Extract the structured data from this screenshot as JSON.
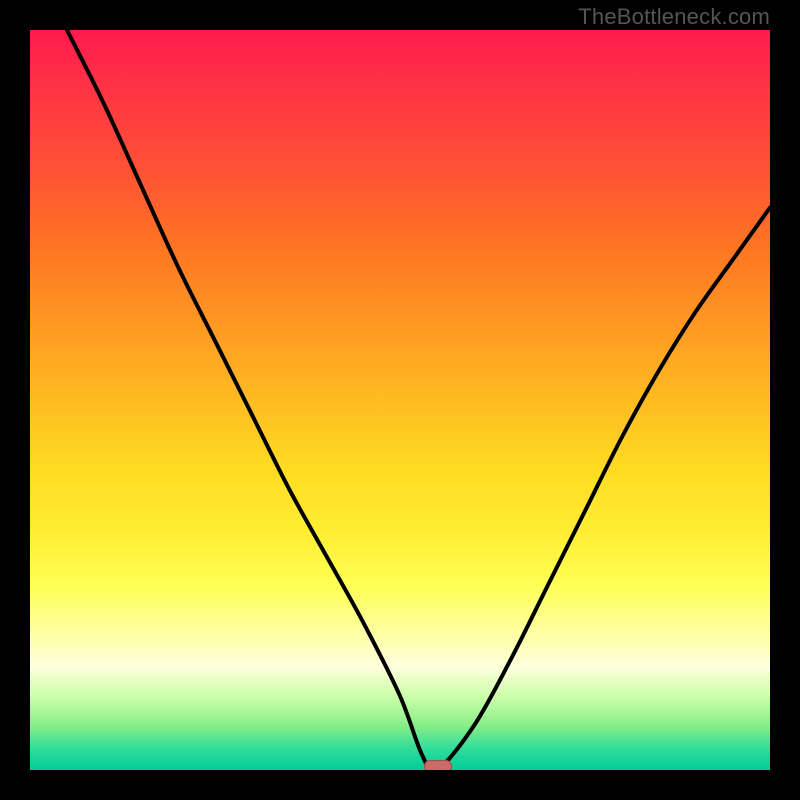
{
  "watermark": "TheBottleneck.com",
  "colors": {
    "top": "#ff1a4d",
    "mid": "#ffee33",
    "bottom": "#00cc99",
    "curve": "#000000",
    "marker": "#c96b66"
  },
  "chart_data": {
    "type": "line",
    "title": "",
    "xlabel": "",
    "ylabel": "",
    "xlim": [
      0,
      100
    ],
    "ylim": [
      0,
      100
    ],
    "grid": false,
    "series": [
      {
        "name": "bottleneck-curve",
        "x": [
          5,
          10,
          15,
          20,
          25,
          30,
          35,
          40,
          45,
          50,
          53,
          55,
          60,
          65,
          70,
          75,
          80,
          85,
          90,
          95,
          100
        ],
        "values": [
          100,
          90,
          79,
          68,
          58,
          48,
          38,
          29,
          20,
          10,
          2,
          0,
          6,
          15,
          25,
          35,
          45,
          54,
          62,
          69,
          76
        ]
      }
    ],
    "marker": {
      "x": 55,
      "y": 0
    },
    "background_gradient": [
      "#ff1a4d",
      "#ffee33",
      "#00cc99"
    ]
  }
}
